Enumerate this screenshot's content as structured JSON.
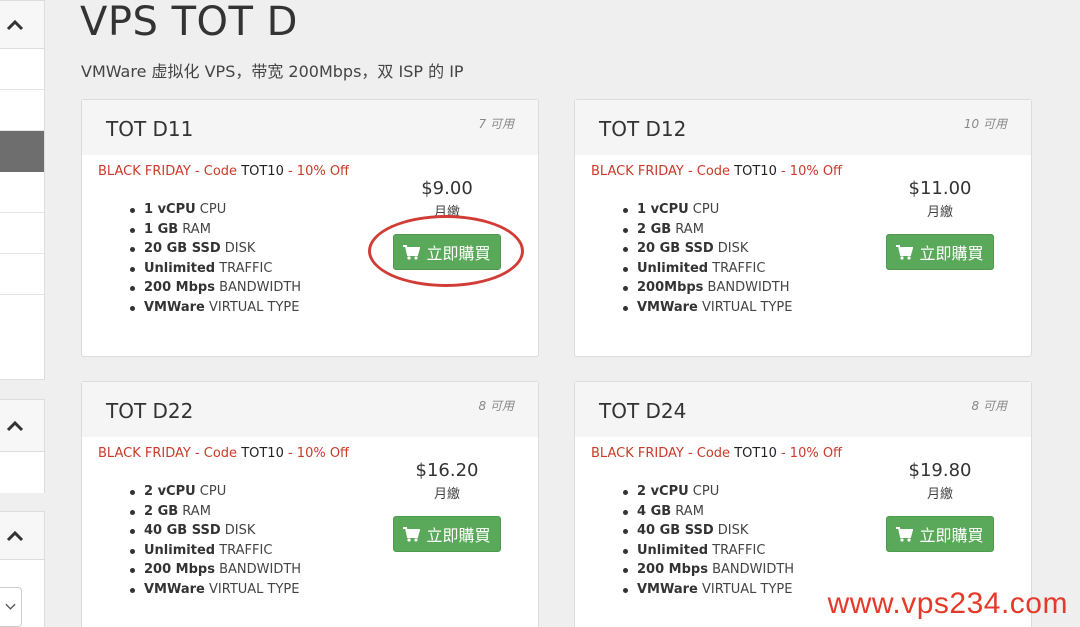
{
  "header": {
    "title": "VPS TOT D",
    "subtitle": "VMWare 虚拟化 VPS，带宽 200Mbps，双 ISP 的 IP"
  },
  "products": [
    {
      "name": "TOT D11",
      "availability": "7 可用",
      "promo": {
        "prefix": "BLACK FRIDAY - Code ",
        "code": "TOT10",
        "suffix": " - 10% Off"
      },
      "features": [
        {
          "value": "1 vCPU",
          "label": " CPU"
        },
        {
          "value": "1 GB",
          "label": " RAM"
        },
        {
          "value": "20 GB SSD",
          "label": " DISK"
        },
        {
          "value": "Unlimited",
          "label": " TRAFFIC"
        },
        {
          "value": "200 Mbps",
          "label": " BANDWIDTH"
        },
        {
          "value": "VMWare",
          "label": " VIRTUAL TYPE"
        }
      ],
      "price": "$9.00",
      "cycle": "月繳",
      "button": "立即購買"
    },
    {
      "name": "TOT D12",
      "availability": "10 可用",
      "promo": {
        "prefix": "BLACK FRIDAY - Code ",
        "code": "TOT10",
        "suffix": " - 10% Off"
      },
      "features": [
        {
          "value": "1 vCPU",
          "label": " CPU"
        },
        {
          "value": "2 GB",
          "label": " RAM"
        },
        {
          "value": "20 GB SSD",
          "label": " DISK"
        },
        {
          "value": "Unlimited",
          "label": " TRAFFIC"
        },
        {
          "value": "200Mbps",
          "label": " BANDWIDTH"
        },
        {
          "value": "VMWare",
          "label": " VIRTUAL TYPE"
        }
      ],
      "price": "$11.00",
      "cycle": "月繳",
      "button": "立即購買"
    },
    {
      "name": "TOT D22",
      "availability": "8 可用",
      "promo": {
        "prefix": "BLACK FRIDAY - Code ",
        "code": "TOT10",
        "suffix": " - 10% Off"
      },
      "features": [
        {
          "value": "2 vCPU",
          "label": " CPU"
        },
        {
          "value": "2 GB",
          "label": " RAM"
        },
        {
          "value": "40 GB SSD",
          "label": " DISK"
        },
        {
          "value": "Unlimited",
          "label": " TRAFFIC"
        },
        {
          "value": "200 Mbps",
          "label": " BANDWIDTH"
        },
        {
          "value": "VMWare",
          "label": " VIRTUAL TYPE"
        }
      ],
      "price": "$16.20",
      "cycle": "月繳",
      "button": "立即購買"
    },
    {
      "name": "TOT D24",
      "availability": "8 可用",
      "promo": {
        "prefix": "BLACK FRIDAY - Code ",
        "code": "TOT10",
        "suffix": " - 10% Off"
      },
      "features": [
        {
          "value": "2 vCPU",
          "label": " CPU"
        },
        {
          "value": "4 GB",
          "label": " RAM"
        },
        {
          "value": "40 GB SSD",
          "label": " DISK"
        },
        {
          "value": "Unlimited",
          "label": " TRAFFIC"
        },
        {
          "value": "200 Mbps",
          "label": " BANDWIDTH"
        },
        {
          "value": "VMWare",
          "label": " VIRTUAL TYPE"
        }
      ],
      "price": "$19.80",
      "cycle": "月繳",
      "button": "立即購買"
    }
  ],
  "watermark": "www.vps234.com",
  "icons": {
    "cart": "shopping-cart-icon",
    "collapse": "chevron-up-icon",
    "dropdown": "chevron-down-icon"
  },
  "colors": {
    "promo": "#c83a2a",
    "button": "#5aa85a",
    "highlight_circle": "#d23c36",
    "watermark": "#e33a2a"
  }
}
